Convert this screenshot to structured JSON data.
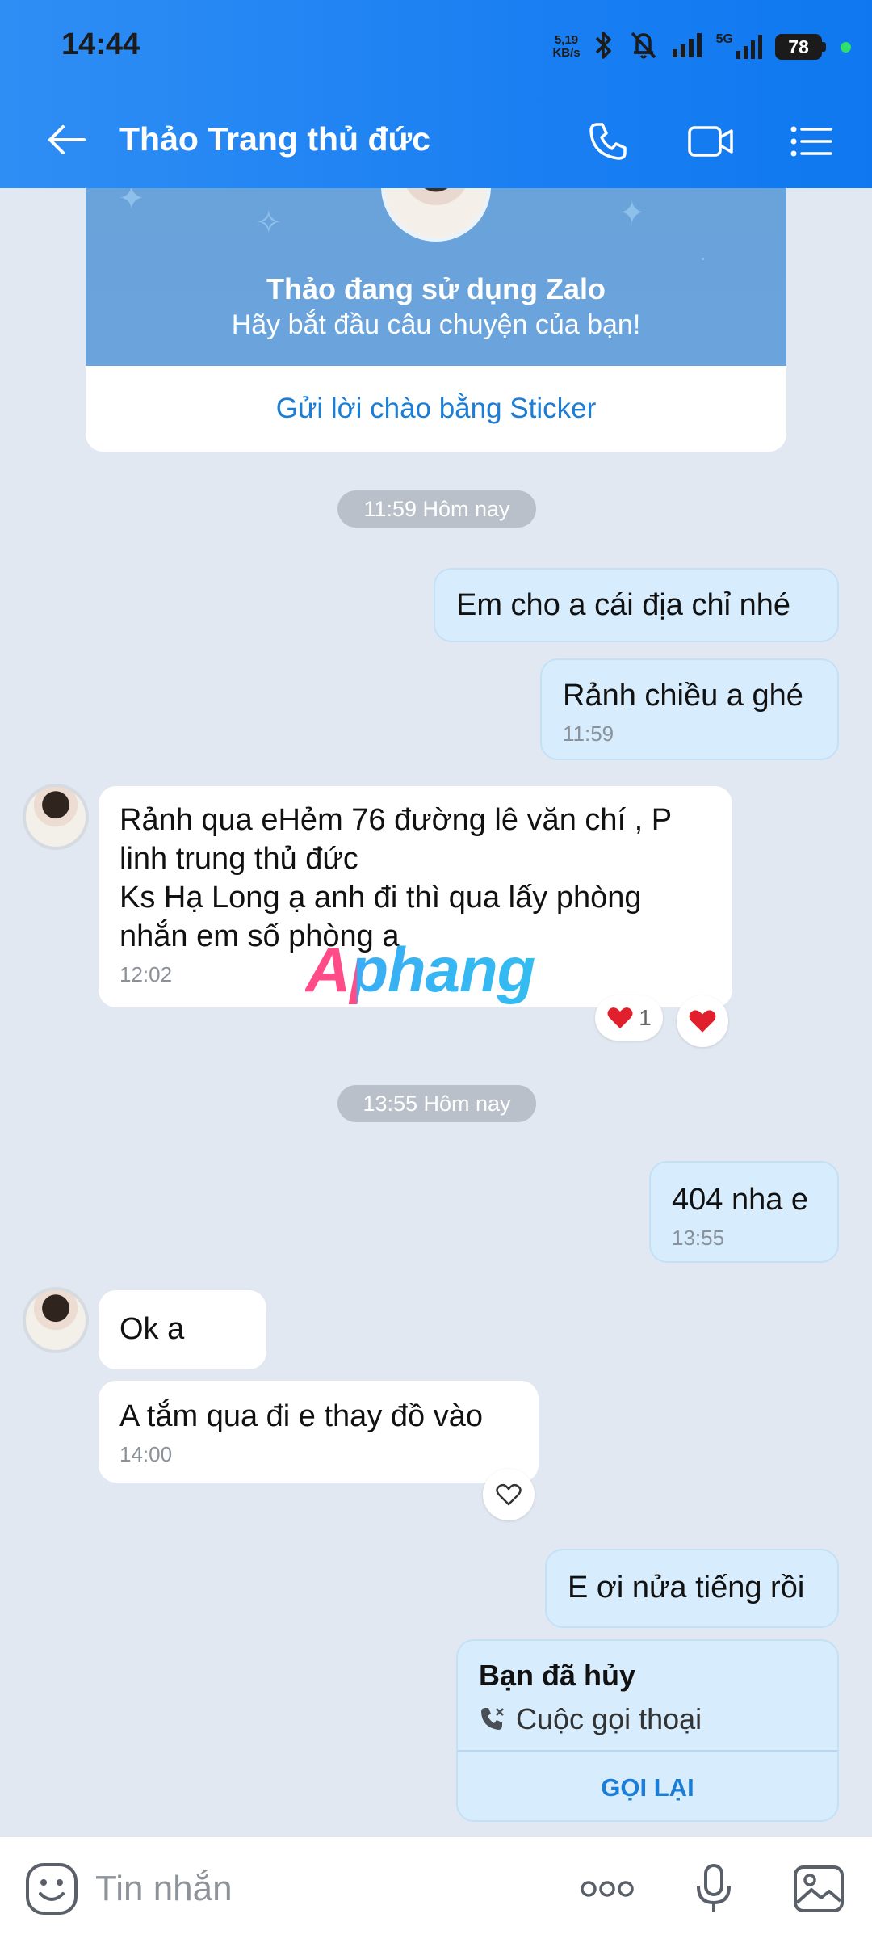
{
  "status_bar": {
    "time": "14:44",
    "net_speed_value": "5,19",
    "net_speed_unit": "KB/s",
    "network_label": "5G",
    "battery": "78"
  },
  "header": {
    "title": "Thảo Trang thủ đức",
    "icons": [
      "back-arrow-icon",
      "phone-icon",
      "video-call-icon",
      "menu-list-icon"
    ],
    "color": "#1a7ff2"
  },
  "profile_card": {
    "name_line": "Thảo đang sử dụng Zalo",
    "subtitle": "Hãy bắt đầu câu chuyện của bạn!",
    "sticker_link": "Gửi lời chào bằng Sticker"
  },
  "messages": {
    "time_divider_1": "11:59 Hôm nay",
    "m1_text": "Em cho a cái địa chỉ nhé",
    "m2_text": "Rảnh chiều a ghé",
    "m2_time": "11:59",
    "m3_text": "Rảnh qua eHẻm 76 đường lê văn chí , P linh trung thủ đức\nKs Hạ Long ạ anh đi thì qua lấy phòng nhắn em số phòng a",
    "m3_time": "12:02",
    "m3_reaction_count": "1",
    "time_divider_2": "13:55 Hôm nay",
    "m4_text": "404 nha e",
    "m4_time": "13:55",
    "m5_text": "Ok a",
    "m6_text": "A tắm qua đi e thay đồ vào",
    "m6_time": "14:00",
    "m7_text": "E ơi nửa tiếng rồi"
  },
  "call_card": {
    "title": "Bạn đã hủy",
    "subtitle": "Cuộc gọi thoại",
    "action": "GỌI LẠI"
  },
  "watermark": "Aphang",
  "input_bar": {
    "placeholder": "Tin nhắn",
    "icons": [
      "sticker-icon",
      "more-icon",
      "microphone-icon",
      "image-icon"
    ]
  },
  "colors": {
    "outgoing_bubble": "#d7ecfc",
    "incoming_bubble": "#ffffff",
    "chat_background": "#e2e8f1",
    "link_blue": "#1c7dd6",
    "heart_red": "#e0202c"
  }
}
